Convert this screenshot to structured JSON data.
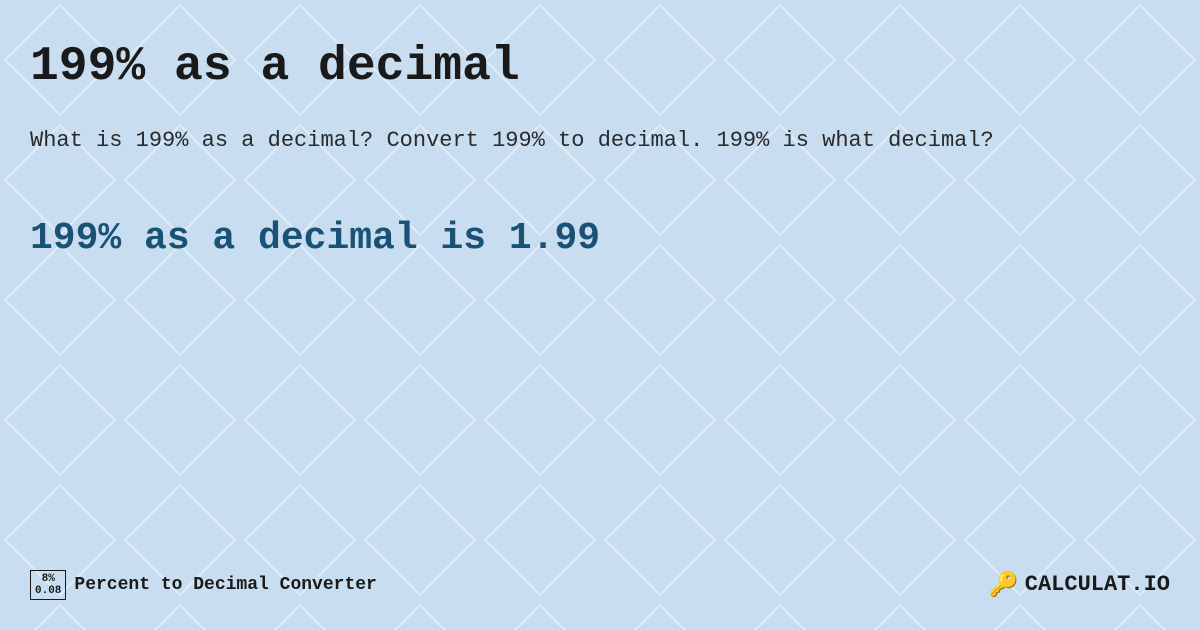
{
  "page": {
    "background_color": "#c8ddf0",
    "title": "199% as a decimal",
    "description": "What is 199% as a decimal? Convert 199% to decimal. 199% is what decimal?",
    "result": "199% as a decimal is 1.99",
    "footer": {
      "badge_top": "8%",
      "badge_bottom": "0.08",
      "converter_label": "Percent to Decimal Converter",
      "logo_text": "CALCULAT.IO"
    }
  }
}
